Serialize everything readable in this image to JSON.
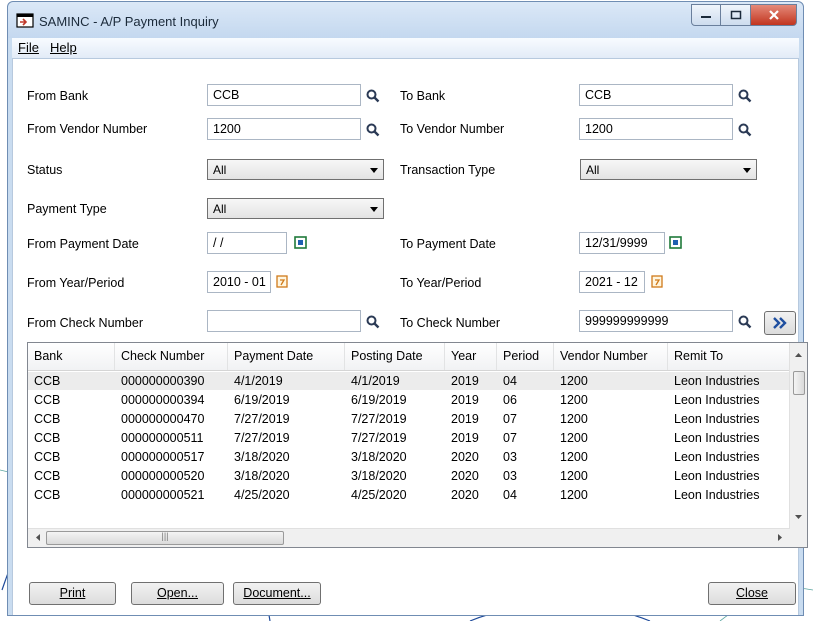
{
  "window": {
    "title": "SAMINC - A/P Payment Inquiry"
  },
  "menu": {
    "file": "File",
    "help": "Help"
  },
  "form": {
    "from_bank": {
      "label": "From Bank",
      "value": "CCB"
    },
    "to_bank": {
      "label": "To Bank",
      "value": "CCB"
    },
    "from_vendor": {
      "label": "From Vendor Number",
      "value": "1200"
    },
    "to_vendor": {
      "label": "To Vendor Number",
      "value": "1200"
    },
    "status": {
      "label": "Status",
      "value": "All"
    },
    "transaction_type": {
      "label": "Transaction Type",
      "value": "All"
    },
    "payment_type": {
      "label": "Payment Type",
      "value": "All"
    },
    "from_payment_date": {
      "label": "From Payment Date",
      "value": " / /"
    },
    "to_payment_date": {
      "label": "To Payment Date",
      "value": "12/31/9999"
    },
    "from_year_period": {
      "label": "From Year/Period",
      "value": "2010 - 01"
    },
    "to_year_period": {
      "label": "To Year/Period",
      "value": "2021 - 12"
    },
    "from_check": {
      "label": "From Check Number",
      "value": ""
    },
    "to_check": {
      "label": "To Check Number",
      "value": "999999999999"
    }
  },
  "grid": {
    "headers": [
      "Bank",
      "Check Number",
      "Payment Date",
      "Posting Date",
      "Year",
      "Period",
      "Vendor Number",
      "Remit To"
    ],
    "rows": [
      [
        "CCB",
        "000000000390",
        "4/1/2019",
        "4/1/2019",
        "2019",
        "04",
        "1200",
        "Leon Industries"
      ],
      [
        "CCB",
        "000000000394",
        "6/19/2019",
        "6/19/2019",
        "2019",
        "06",
        "1200",
        "Leon Industries"
      ],
      [
        "CCB",
        "000000000470",
        "7/27/2019",
        "7/27/2019",
        "2019",
        "07",
        "1200",
        "Leon Industries"
      ],
      [
        "CCB",
        "000000000511",
        "7/27/2019",
        "7/27/2019",
        "2019",
        "07",
        "1200",
        "Leon Industries"
      ],
      [
        "CCB",
        "000000000517",
        "3/18/2020",
        "3/18/2020",
        "2020",
        "03",
        "1200",
        "Leon Industries"
      ],
      [
        "CCB",
        "000000000520",
        "3/18/2020",
        "3/18/2020",
        "2020",
        "03",
        "1200",
        "Leon Industries"
      ],
      [
        "CCB",
        "000000000521",
        "4/25/2020",
        "4/25/2020",
        "2020",
        "04",
        "1200",
        "Leon Industries"
      ]
    ]
  },
  "buttons": {
    "print": "Print",
    "open": "Open...",
    "document": "Document...",
    "close": "Close"
  },
  "icons": {
    "lookup": "magnifier-icon",
    "calendar": "calendar-icon",
    "finder": "finder-icon",
    "next": "double-chevron-icon"
  },
  "colors": {
    "title_bar": "#c4d8ef",
    "close_button": "#c2351f",
    "accent": "#1f5fb0"
  }
}
